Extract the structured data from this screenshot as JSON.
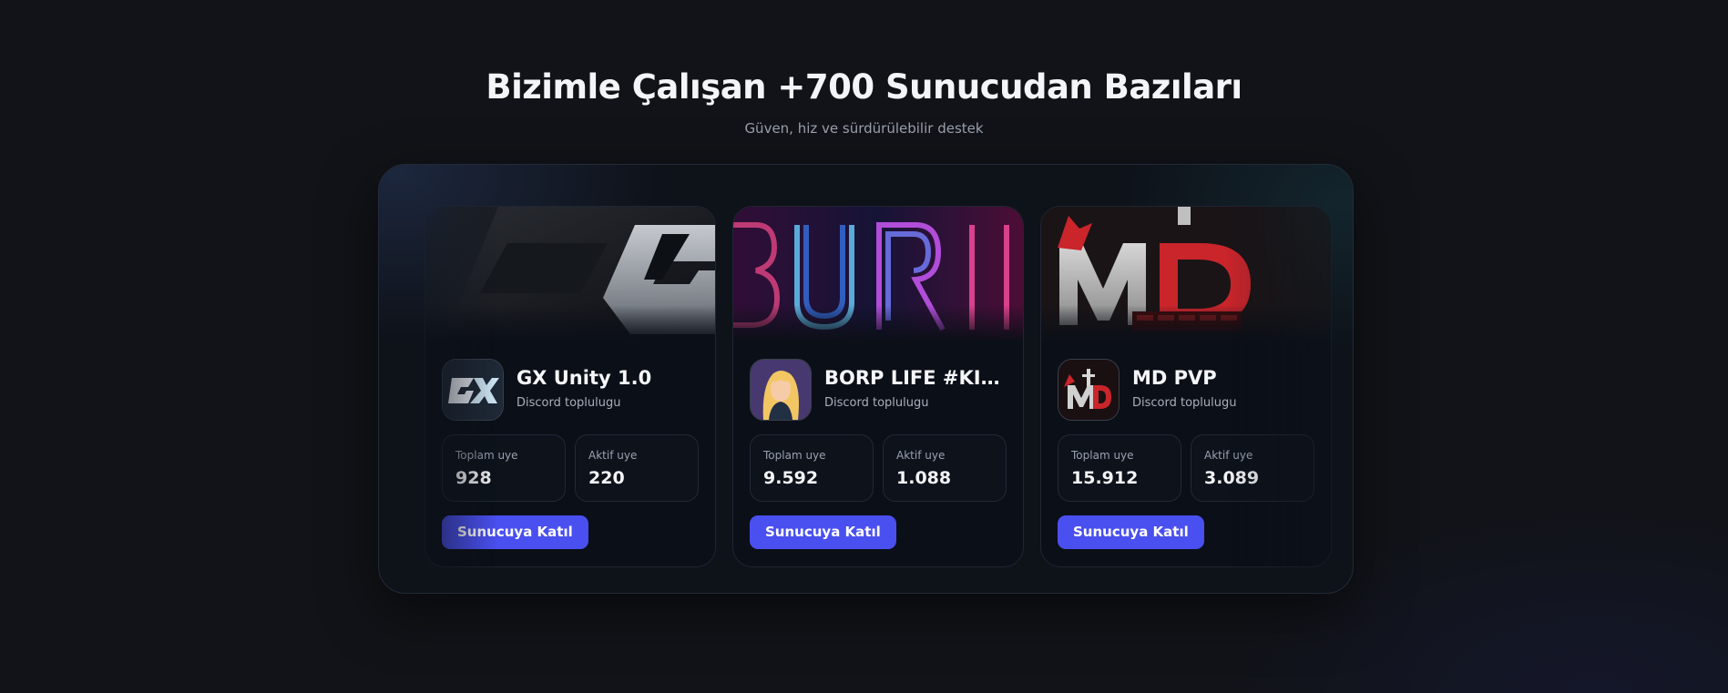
{
  "section": {
    "title": "Bizimle Çalışan +700 Sunucudan Bazıları",
    "subtitle": "Güven, hiz ve sürdürülebilir destek"
  },
  "servers": [
    {
      "name": "GX Unity 1.0",
      "type": "Discord toplulugu",
      "total_label": "Toplam uye",
      "total": "928",
      "active_label": "Aktif uye",
      "active": "220",
      "join_label": "Sunucuya Katıl",
      "logo_text": "GX"
    },
    {
      "name": "BORP LIFE #KISA ...",
      "type": "Discord toplulugu",
      "total_label": "Toplam uye",
      "total": "9.592",
      "active_label": "Aktif uye",
      "active": "1.088",
      "join_label": "Sunucuya Katıl",
      "logo_text": "BURP"
    },
    {
      "name": "MD PVP",
      "type": "Discord toplulugu",
      "total_label": "Toplam uye",
      "total": "15.912",
      "active_label": "Aktif uye",
      "active": "3.089",
      "join_label": "Sunucuya Katıl",
      "logo_text": "MD"
    }
  ],
  "colors": {
    "background": "#111318",
    "accent": "#4a4ff0",
    "card": "#0b0f17"
  }
}
